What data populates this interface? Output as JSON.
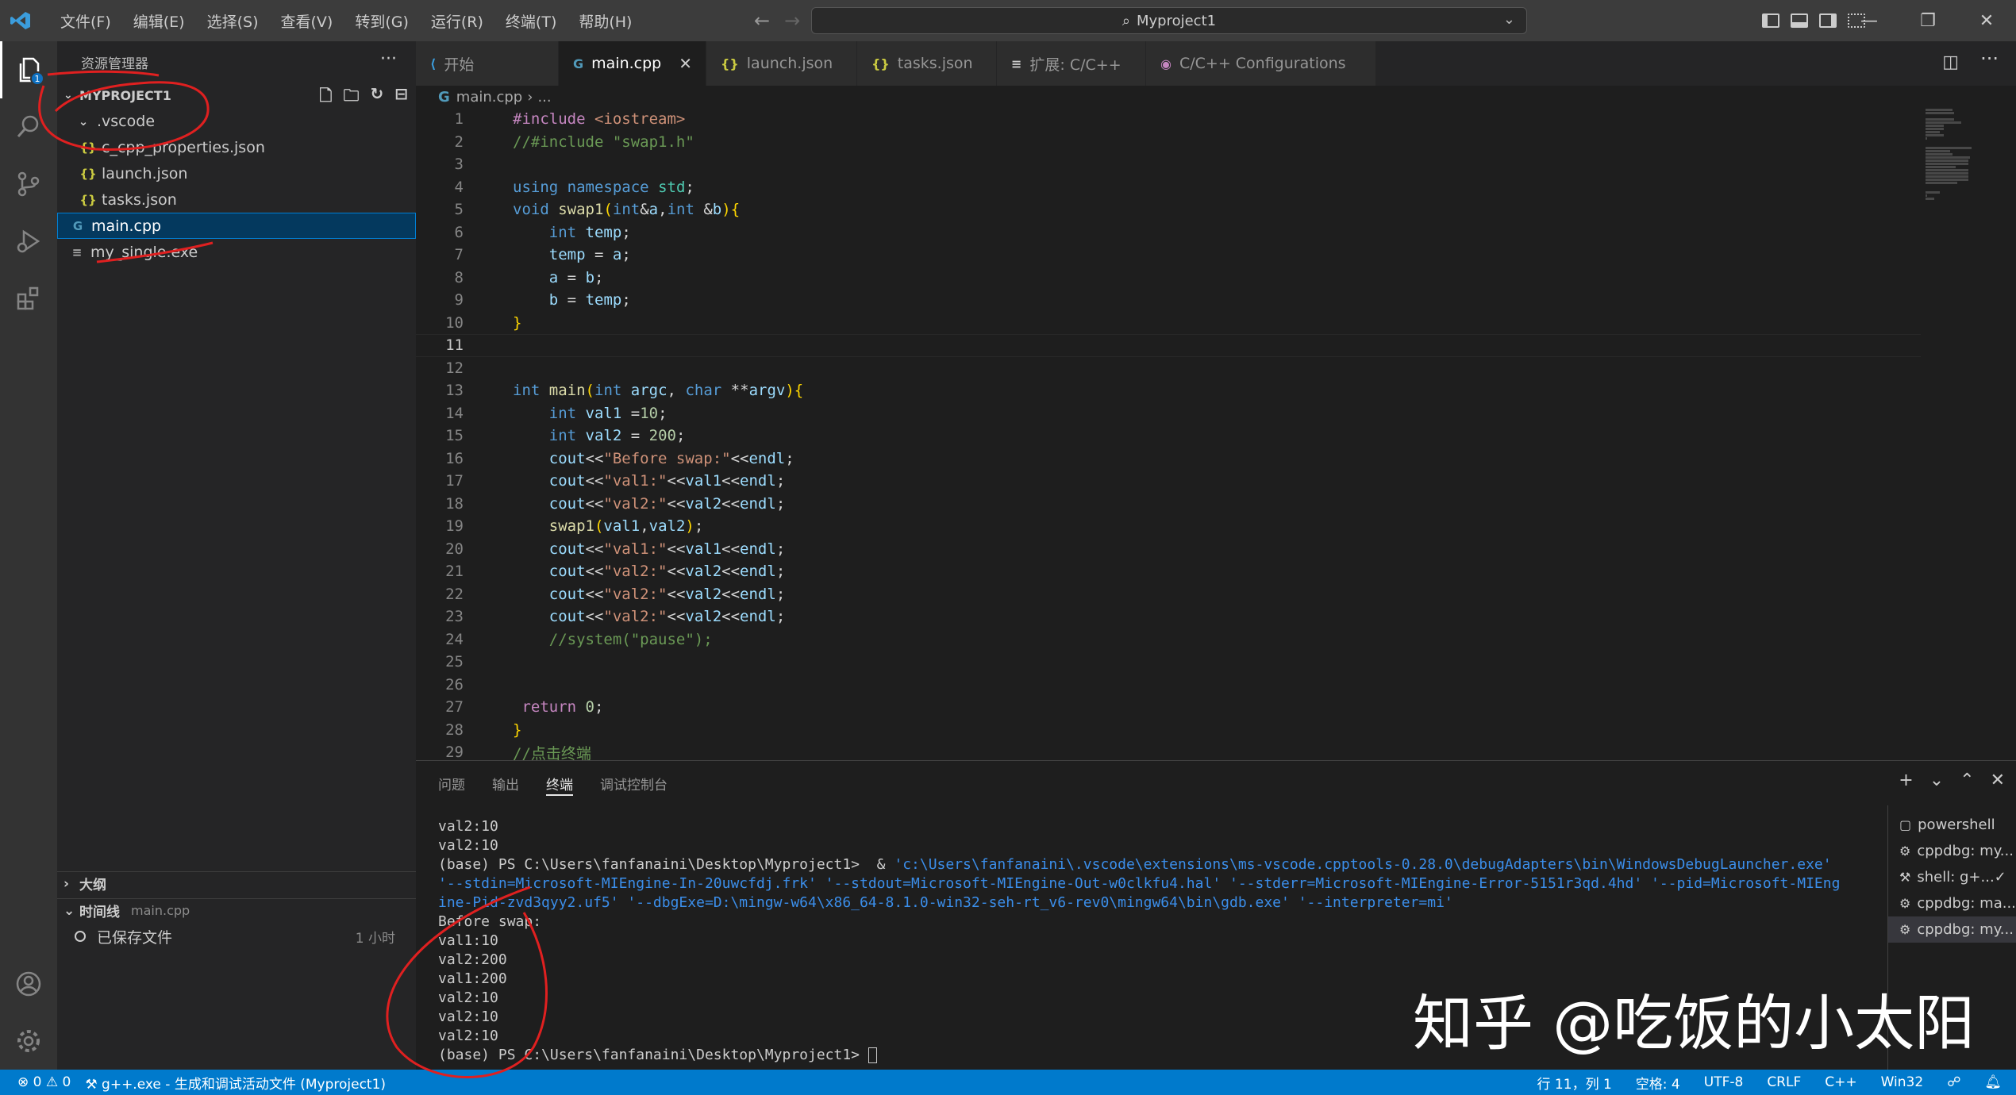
{
  "menu": [
    "文件(F)",
    "编辑(E)",
    "选择(S)",
    "查看(V)",
    "转到(G)",
    "运行(R)",
    "终端(T)",
    "帮助(H)"
  ],
  "command_center": "Myproject1",
  "sidebar": {
    "title": "资源管理器",
    "project": "MYPROJECT1",
    "items": [
      {
        "label": ".vscode",
        "type": "folder"
      },
      {
        "label": "c_cpp_properties.json",
        "type": "json"
      },
      {
        "label": "launch.json",
        "type": "json"
      },
      {
        "label": "tasks.json",
        "type": "json"
      },
      {
        "label": "main.cpp",
        "type": "cpp",
        "selected": true
      },
      {
        "label": "my_single.exe",
        "type": "exe"
      }
    ],
    "outline": "大纲",
    "timeline": "时间线",
    "timeline_file": "main.cpp",
    "timeline_item": "已保存文件",
    "timeline_time": "1 小时"
  },
  "tabs": [
    {
      "label": "开始"
    },
    {
      "label": "main.cpp",
      "active": true
    },
    {
      "label": "launch.json"
    },
    {
      "label": "tasks.json",
      "dirty": true
    },
    {
      "label": "扩展: C/C++"
    },
    {
      "label": "C/C++ Configurations"
    }
  ],
  "breadcrumb": [
    "main.cpp",
    "..."
  ],
  "code_lines": [
    "#include <iostream>",
    "//#include \"swap1.h\"",
    "",
    "using namespace std;",
    "void swap1(int&a,int &b){",
    "    int temp;",
    "    temp = a;",
    "    a = b;",
    "    b = temp;",
    "}",
    "",
    "",
    "int main(int argc, char **argv){",
    "    int val1 =10;",
    "    int val2 = 200;",
    "    cout<<\"Before swap:\"<<endl;",
    "    cout<<\"val1:\"<<val1<<endl;",
    "    cout<<\"val2:\"<<val2<<endl;",
    "    swap1(val1,val2);",
    "    cout<<\"val1:\"<<val1<<endl;",
    "    cout<<\"val2:\"<<val2<<endl;",
    "    cout<<\"val2:\"<<val2<<endl;",
    "    cout<<\"val2:\"<<val2<<endl;",
    "    //system(\"pause\");",
    "",
    "",
    " return 0;",
    "}",
    "//点击终端"
  ],
  "current_line": 11,
  "panel": {
    "tabs": [
      "问题",
      "输出",
      "终端",
      "调试控制台"
    ],
    "active_tab": "终端",
    "terminal_lines": [
      {
        "text": "val2:10"
      },
      {
        "text": "val2:10"
      },
      {
        "prefix": "(base) PS C:\\Users\\fanfanaini\\Desktop\\Myproject1>  & ",
        "text": "'c:\\Users\\fanfanaini\\.vscode\\extensions\\ms-vscode.cpptools-0.28.0\\debugAdapters\\bin\\WindowsDebugLauncher.exe'"
      },
      {
        "blue": true,
        "text": "'--stdin=Microsoft-MIEngine-In-20uwcfdj.frk' '--stdout=Microsoft-MIEngine-Out-w0clkfu4.hal' '--stderr=Microsoft-MIEngine-Error-5151r3qd.4hd' '--pid=Microsoft-MIEng"
      },
      {
        "blue": true,
        "text": "ine-Pid-zvd3qyy2.uf5' '--dbgExe=D:\\mingw-w64\\x86_64-8.1.0-win32-seh-rt_v6-rev0\\mingw64\\bin\\gdb.exe' '--interpreter=mi'"
      },
      {
        "text": "Before swap:"
      },
      {
        "text": "val1:10"
      },
      {
        "text": "val2:200"
      },
      {
        "text": "val1:200"
      },
      {
        "text": "val2:10"
      },
      {
        "text": "val2:10"
      },
      {
        "text": "val2:10"
      },
      {
        "text": "(base) PS C:\\Users\\fanfanaini\\Desktop\\Myproject1> ",
        "cursor": true
      }
    ],
    "terminals": [
      {
        "label": "powershell",
        "icon": "terminal-icon"
      },
      {
        "label": "cppdbg: my...",
        "icon": "debug-icon"
      },
      {
        "label": "shell: g+...",
        "icon": "tools-icon",
        "check": true
      },
      {
        "label": "cppdbg: ma...",
        "icon": "debug-icon"
      },
      {
        "label": "cppdbg: my...",
        "icon": "debug-icon",
        "active": true
      }
    ]
  },
  "status": {
    "errors": "0",
    "warnings": "0",
    "task": "g++.exe - 生成和调试活动文件 (Myproject1)",
    "position": "行 11，列 1",
    "spaces": "空格: 4",
    "encoding": "UTF-8",
    "eol": "CRLF",
    "language": "C++",
    "platform": "Win32"
  },
  "watermark": "知乎 @吃饭的小太阳",
  "colors": {
    "accent": "#007acc",
    "annotation": "#e02020"
  }
}
